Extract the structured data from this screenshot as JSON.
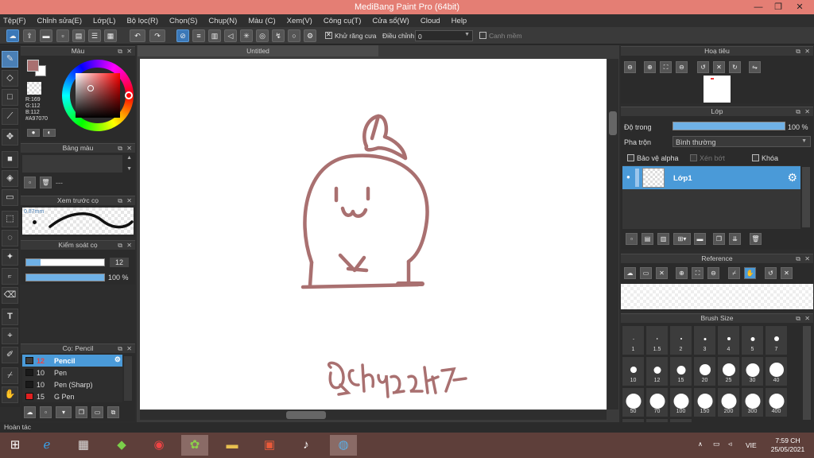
{
  "window": {
    "title": "MediBang Paint Pro (64bit)",
    "minimize": "—",
    "restore": "❐",
    "close": "✕"
  },
  "menu": [
    "Tệp(F)",
    "Chỉnh sửa(E)",
    "Lớp(L)",
    "Bộ lọc(R)",
    "Chọn(S)",
    "Chụp(N)",
    "Màu (C)",
    "Xem(V)",
    "Công cụ(T)",
    "Cửa sổ(W)",
    "Cloud",
    "Help"
  ],
  "toolbar": {
    "antialias_label": "Khử răng cưa",
    "adjust_label": "Điều chỉnh",
    "adjust_value": "0",
    "edge_label": "Canh mềm",
    "antialias_checked": true,
    "edge_checked": false
  },
  "color_panel": {
    "title": "Màu",
    "r": "R:169",
    "g": "G:112",
    "b": "B:112",
    "hex": "#A97070",
    "primary": "#a97070",
    "secondary": "#ffffff"
  },
  "palette_panel": {
    "title": "Bảng màu",
    "more": "---"
  },
  "brush_preview": {
    "title": "Xem trước cọ",
    "size": "0.87mm"
  },
  "brush_control": {
    "title": "Kiểm soát cọ",
    "size": "12",
    "opacity": "100 %",
    "size_fraction": 0.18,
    "opacity_fraction": 1.0
  },
  "brush_list": {
    "title": "Cọ: Pencil",
    "items": [
      {
        "size": "12",
        "name": "Pencil",
        "color": "#3c3c3c",
        "selected": true
      },
      {
        "size": "10",
        "name": "Pen",
        "color": "#1a1a1a",
        "selected": false
      },
      {
        "size": "10",
        "name": "Pen (Sharp)",
        "color": "#1a1a1a",
        "selected": false
      },
      {
        "size": "15",
        "name": "G Pen",
        "color": "#e02020",
        "selected": false
      }
    ]
  },
  "document": {
    "tab": "Untitled",
    "signature": "Qchyz2h7"
  },
  "navigator": {
    "title": "Hoạ tiêu"
  },
  "layer_panel": {
    "title": "Lớp",
    "opacity_label": "Độ trong",
    "opacity_value": "100 %",
    "opacity_fraction": 1.0,
    "blend_label": "Pha trộn",
    "blend_value": "Bình thường",
    "protect_alpha": "Bảo vệ alpha",
    "clipping": "Xén bớt",
    "lock": "Khóa",
    "layer_name": "Lớp1"
  },
  "reference_panel": {
    "title": "Reference"
  },
  "brush_size_panel": {
    "title": "Brush Size",
    "sizes": [
      "1",
      "1.5",
      "2",
      "3",
      "4",
      "5",
      "7",
      "10",
      "12",
      "15",
      "20",
      "25",
      "30",
      "40",
      "50",
      "70",
      "100",
      "150",
      "200",
      "300",
      "400",
      "",
      "",
      ""
    ]
  },
  "status": {
    "text": "Hoàn tác"
  },
  "taskbar": {
    "lang": "VIE",
    "time": "7:59 CH",
    "date": "25/05/2021"
  },
  "colors": {
    "titlebar": "#e47e74",
    "accent": "#4a9ad8",
    "drawing": "#a97070"
  }
}
